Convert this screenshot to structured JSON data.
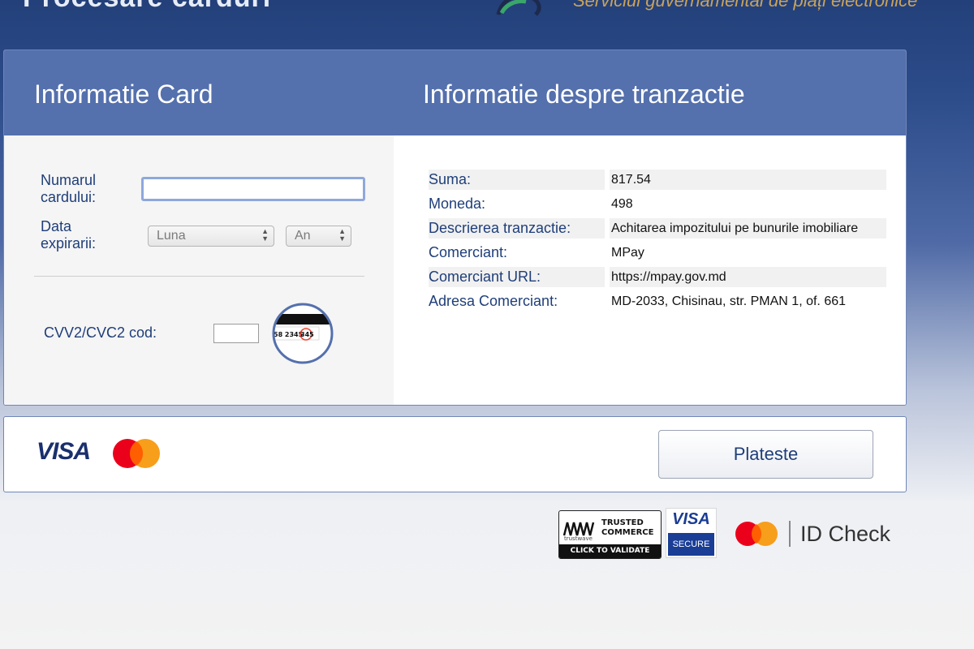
{
  "header": {
    "left_text": "Procesare carduri",
    "right_text": "Serviciul guvernamental de plăți electronice"
  },
  "card_section": {
    "title": "Informatie Card",
    "card_number_label": "Numarul cardului:",
    "card_number_value": "",
    "expiry_label": "Data expirarii:",
    "month_select": "Luna",
    "year_select": "An",
    "cvv_label": "CVV2/CVC2 cod:",
    "cvv_value": "",
    "cvv_image_text": "58 2345",
    "cvv_image_code": "345"
  },
  "transaction_section": {
    "title": "Informatie despre tranzactie",
    "rows": [
      {
        "label": "Suma:",
        "value": "817.54"
      },
      {
        "label": "Moneda:",
        "value": "498"
      },
      {
        "label": "Descrierea tranzactie:",
        "value": "Achitarea impozitului pe bunurile imobiliare"
      },
      {
        "label": "Comerciant:",
        "value": "MPay"
      },
      {
        "label": "Comerciant URL:",
        "value": "https://mpay.gov.md"
      },
      {
        "label": "Adresa Comerciant:",
        "value": "MD-2033, Chisinau, str. PMAN 1, of. 661"
      }
    ]
  },
  "footer": {
    "visa_logo": "VISA",
    "pay_button": "Plateste"
  },
  "badges": {
    "trusted_line1": "TRUSTED",
    "trusted_line2": "COMMERCE",
    "trusted_small": "trustwave",
    "trusted_cta": "CLICK TO VALIDATE",
    "visa_secure_top": "VISA",
    "visa_secure_bottom": "SECURE",
    "id_check": "ID Check"
  },
  "colors": {
    "header_blue": "#5470ad",
    "label_blue": "#1f3e79",
    "mastercard_red": "#eb001b",
    "mastercard_orange": "#f79e1b"
  }
}
